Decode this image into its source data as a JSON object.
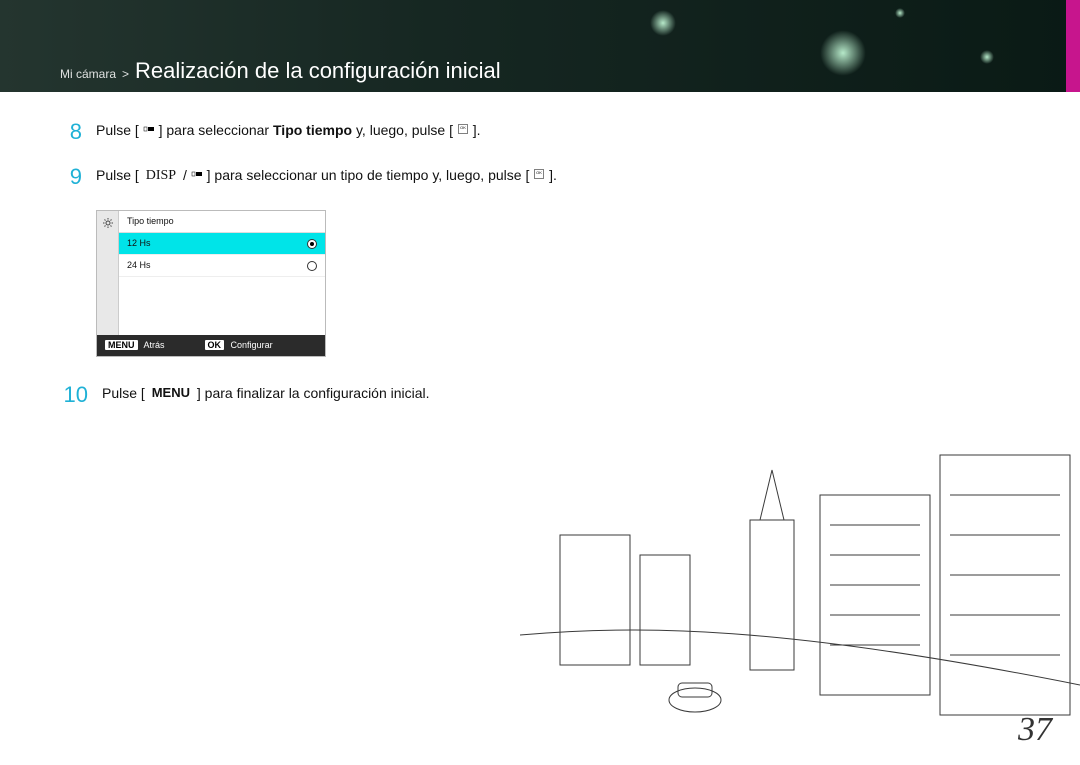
{
  "breadcrumb": {
    "section": "Mi cámara",
    "title": "Realización de la configuración inicial"
  },
  "steps": {
    "s8": {
      "num": "8",
      "pre": "Pulse [",
      "mid": "] para seleccionar ",
      "bold": "Tipo tiempo",
      "post": " y, luego, pulse [",
      "tail": "]."
    },
    "s9": {
      "num": "9",
      "pre": "Pulse [",
      "disp": "DISP",
      "slash": "/",
      "mid": "] para seleccionar un tipo de tiempo y, luego, pulse [",
      "tail": "]."
    },
    "s10": {
      "num": "10",
      "pre": "Pulse [",
      "menu": "MENU",
      "post": "] para finalizar la configuración inicial."
    }
  },
  "camera": {
    "title": "Tipo tiempo",
    "opt1": "12 Hs",
    "opt2": "24 Hs",
    "back_tag": "MENU",
    "back_label": "Atrás",
    "ok_tag": "OK",
    "ok_label": "Configurar"
  },
  "icons": {
    "nav": "nav-icon",
    "ok": "ok-icon",
    "gear": "gear-icon"
  },
  "page_number": "37"
}
